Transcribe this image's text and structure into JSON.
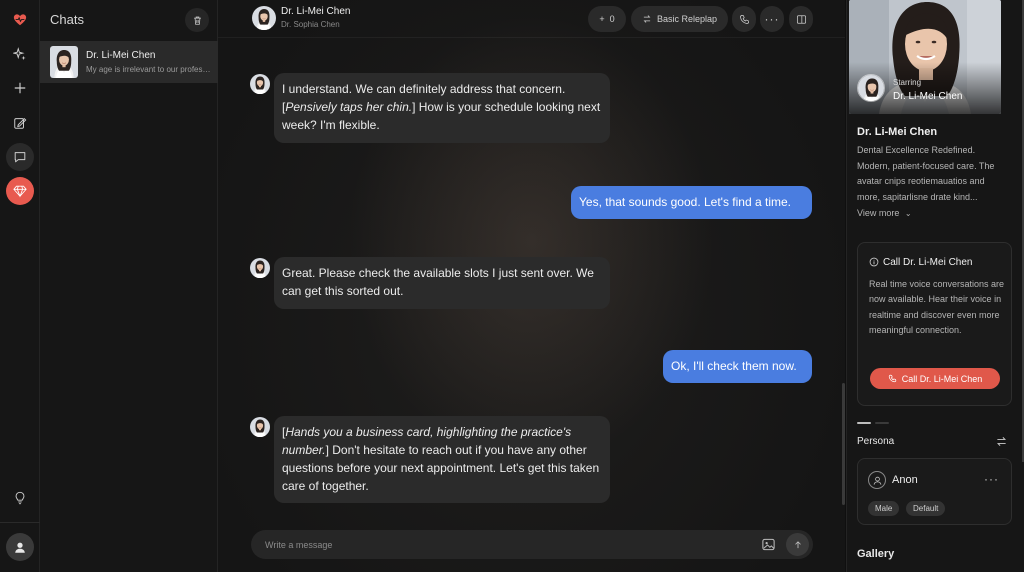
{
  "rail": {
    "icons": [
      "heart-pulse-icon",
      "sparkle-icon",
      "plus-icon",
      "edit-icon",
      "chat-icon",
      "gem-icon",
      "lightbulb-icon",
      "user-avatar"
    ],
    "accent": "#e85a4f"
  },
  "chats": {
    "title": "Chats",
    "items": [
      {
        "name": "Dr. Li-Mei Chen",
        "preview": "My age is irrelevant to our profession..."
      }
    ]
  },
  "header": {
    "name": "Dr. Li-Mei Chen",
    "subtitle": "Dr. Sophia Chen",
    "count_label": "0",
    "mode_label": "Basic Releplap"
  },
  "messages": [
    {
      "role": "bot",
      "parts": [
        {
          "t": "I understand. We can definitely address that concern. ["
        },
        {
          "t": "Pensively taps her chin.",
          "i": true
        },
        {
          "t": "] How is your schedule looking next week? I'm flexible."
        }
      ]
    },
    {
      "role": "me",
      "text": "Yes, that sounds good. Let's find a time."
    },
    {
      "role": "bot",
      "parts": [
        {
          "t": "Great. Please check the available slots I just sent over. We can get this sorted out."
        }
      ]
    },
    {
      "role": "me",
      "text": "Ok, I'll check them now."
    },
    {
      "role": "bot",
      "parts": [
        {
          "t": "["
        },
        {
          "t": "Hands you a business card, highlighting the practice's number.",
          "i": true
        },
        {
          "t": "] Don't hesitate to reach out if you have any other questions before your next appointment. Let's get this taken care of together."
        }
      ]
    }
  ],
  "composer": {
    "placeholder": "Write a message"
  },
  "panel": {
    "starring_label": "Starring",
    "starring_name": "Dr. Li-Mei Chen",
    "title": "Dr. Li-Mei Chen",
    "description": "Dental Excellence Redefined. Modern, patient-focused care. The avatar cnips reotiemauatios and more, sapitarlisne drate kind...",
    "view_more": "View more",
    "call_card": {
      "title": "Call Dr. Li-Mei Chen",
      "description": "Real time voice conversations are now available. Hear their voice in realtime and discover even more meaningful connection.",
      "button": "Call Dr. Li-Mei Chen"
    },
    "persona_label": "Persona",
    "persona": {
      "name": "Anon",
      "tags": [
        "Male",
        "Default"
      ]
    },
    "gallery_label": "Gallery"
  },
  "colors": {
    "user_bubble": "#4a7de0",
    "bot_bubble": "#2b2b2b",
    "call_button": "#e0584a"
  }
}
